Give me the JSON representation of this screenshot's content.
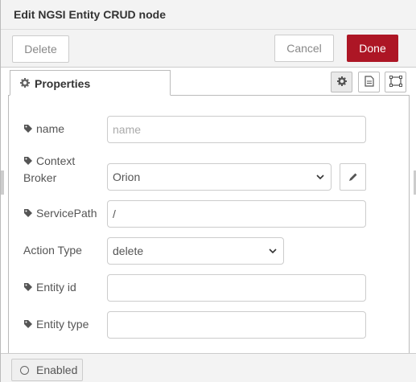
{
  "header": {
    "title": "Edit NGSI Entity CRUD node"
  },
  "toolbar": {
    "delete_label": "Delete",
    "cancel_label": "Cancel",
    "done_label": "Done"
  },
  "tabs": {
    "properties_label": "Properties",
    "icons": [
      "gear-icon",
      "description-icon",
      "appearance-icon"
    ]
  },
  "form": {
    "name": {
      "label": "name",
      "placeholder": "name",
      "value": ""
    },
    "context_broker": {
      "label_line1": "Context",
      "label_line2": "Broker",
      "value": "Orion"
    },
    "service_path": {
      "label": "ServicePath",
      "value": "/"
    },
    "action_type": {
      "label": "Action Type",
      "value": "delete"
    },
    "entity_id": {
      "label": "Entity id",
      "value": ""
    },
    "entity_type": {
      "label": "Entity type",
      "value": ""
    }
  },
  "footer": {
    "enabled_label": "Enabled"
  },
  "colors": {
    "primary": "#ad1625",
    "tray_bg": "#f3f3f3",
    "border": "#cccccc"
  }
}
